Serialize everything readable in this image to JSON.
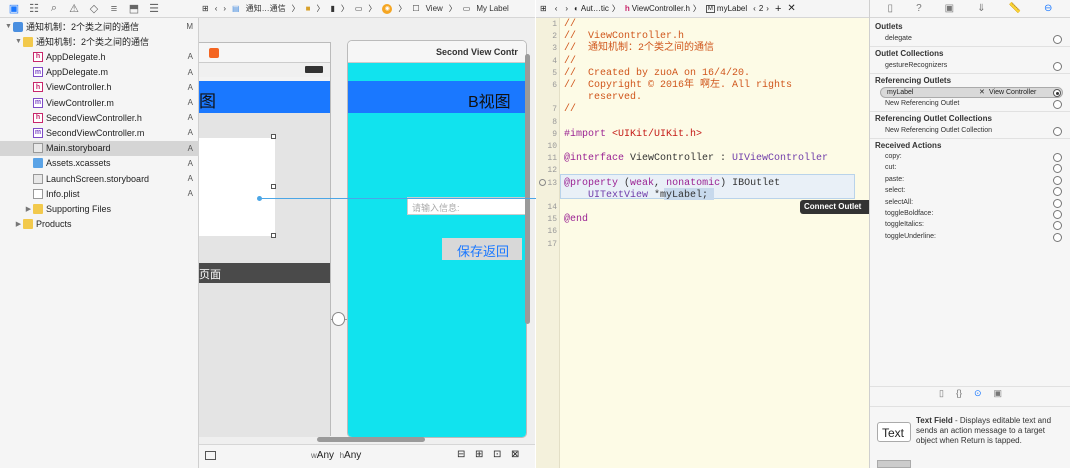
{
  "navigator": {
    "rows": [
      {
        "label": "通知机制：2个类之间的通信",
        "status": "M",
        "icon": "project-icon",
        "indent": 0,
        "disclosure": "▼"
      },
      {
        "label": "通知机制：2个类之间的通信",
        "status": "",
        "icon": "folder-icon",
        "indent": 1,
        "disclosure": "▼"
      },
      {
        "label": "AppDelegate.h",
        "status": "A",
        "icon": "header-file-icon",
        "indent": 2
      },
      {
        "label": "AppDelegate.m",
        "status": "A",
        "icon": "implementation-file-icon",
        "indent": 2
      },
      {
        "label": "ViewController.h",
        "status": "A",
        "icon": "header-file-icon",
        "indent": 2
      },
      {
        "label": "ViewController.m",
        "status": "A",
        "icon": "implementation-file-icon",
        "indent": 2
      },
      {
        "label": "SecondViewController.h",
        "status": "A",
        "icon": "header-file-icon",
        "indent": 2
      },
      {
        "label": "SecondViewController.m",
        "status": "A",
        "icon": "implementation-file-icon",
        "indent": 2
      },
      {
        "label": "Main.storyboard",
        "status": "A",
        "icon": "storyboard-icon",
        "indent": 2,
        "selected": true
      },
      {
        "label": "Assets.xcassets",
        "status": "A",
        "icon": "asset-catalog-icon",
        "indent": 2
      },
      {
        "label": "LaunchScreen.storyboard",
        "status": "A",
        "icon": "storyboard-icon",
        "indent": 2
      },
      {
        "label": "Info.plist",
        "status": "A",
        "icon": "plist-icon",
        "indent": 2
      },
      {
        "label": "Supporting Files",
        "status": "",
        "icon": "folder-icon",
        "indent": 2,
        "disclosure": "▶"
      },
      {
        "label": "Products",
        "status": "",
        "icon": "folder-icon",
        "indent": 1,
        "disclosure": "▶"
      }
    ]
  },
  "ib_jumpbar": {
    "seg1": "通知…通信",
    "seg2": "View",
    "seg3": "My Label"
  },
  "canvas": {
    "scene1_title_partial": "图",
    "scene1_footer_partial": "页面",
    "scene2_title": "Second View Contr",
    "scene2_header": "B视图",
    "scene2_placeholder": "请输入信息:",
    "scene2_button": "保存返回",
    "connect_tooltip": "Connect Outlet"
  },
  "ib_bottom": {
    "w_prefix": "w",
    "w_label": "Any",
    "h_prefix": "h",
    "h_label": "Any"
  },
  "editor_jumpbar": {
    "seg1": "Aut…tic",
    "seg2": "ViewController.h",
    "seg3": "myLabel",
    "counter": "2"
  },
  "code": [
    {
      "n": "1",
      "parts": [
        {
          "c": "com",
          "t": "//"
        }
      ]
    },
    {
      "n": "2",
      "parts": [
        {
          "c": "com",
          "t": "//  ViewController.h"
        }
      ]
    },
    {
      "n": "3",
      "parts": [
        {
          "c": "com",
          "t": "//  通知机制：2个类之间的通信"
        }
      ]
    },
    {
      "n": "4",
      "parts": [
        {
          "c": "com",
          "t": "//"
        }
      ]
    },
    {
      "n": "5",
      "parts": [
        {
          "c": "com",
          "t": "//  Created by zuoA on 16/4/20."
        }
      ]
    },
    {
      "n": "6",
      "parts": [
        {
          "c": "com",
          "t": "//  Copyright © 2016年 啊左. All rights"
        }
      ]
    },
    {
      "n": "",
      "parts": [
        {
          "c": "com",
          "t": "    reserved."
        }
      ]
    },
    {
      "n": "7",
      "parts": [
        {
          "c": "com",
          "t": "//"
        }
      ]
    },
    {
      "n": "8",
      "parts": [
        {
          "c": "plain",
          "t": ""
        }
      ]
    },
    {
      "n": "9",
      "parts": [
        {
          "c": "kw",
          "t": "#import "
        },
        {
          "c": "str",
          "t": "<UIKit/UIKit.h>"
        }
      ]
    },
    {
      "n": "10",
      "parts": [
        {
          "c": "plain",
          "t": ""
        }
      ]
    },
    {
      "n": "11",
      "parts": [
        {
          "c": "kw",
          "t": "@interface "
        },
        {
          "c": "plain",
          "t": "ViewController : "
        },
        {
          "c": "type",
          "t": "UIViewController"
        }
      ]
    },
    {
      "n": "12",
      "parts": [
        {
          "c": "plain",
          "t": ""
        }
      ]
    },
    {
      "n": "13",
      "parts": [
        {
          "c": "kw",
          "t": "@property "
        },
        {
          "c": "plain",
          "t": "("
        },
        {
          "c": "kw",
          "t": "weak"
        },
        {
          "c": "plain",
          "t": ", "
        },
        {
          "c": "kw",
          "t": "nonatomic"
        },
        {
          "c": "plain",
          "t": ") IBOutlet"
        }
      ]
    },
    {
      "n": "",
      "parts": [
        {
          "c": "type",
          "t": "    UITextView"
        },
        {
          "c": "plain",
          "t": " *myLabel;"
        }
      ]
    },
    {
      "n": "14",
      "parts": [
        {
          "c": "plain",
          "t": ""
        }
      ]
    },
    {
      "n": "15",
      "parts": [
        {
          "c": "kw",
          "t": "@end"
        }
      ]
    },
    {
      "n": "16",
      "parts": [
        {
          "c": "plain",
          "t": ""
        }
      ]
    },
    {
      "n": "17",
      "parts": [
        {
          "c": "plain",
          "t": ""
        }
      ]
    }
  ],
  "inspector": {
    "outlets_title": "Outlets",
    "outlets": [
      "delegate"
    ],
    "outlet_collections_title": "Outlet Collections",
    "outlet_collections": [
      "gestureRecognizers"
    ],
    "referencing_outlets_title": "Referencing Outlets",
    "ref_outlet_name": "myLabel",
    "ref_outlet_target": "View Controller",
    "new_ref_outlet": "New Referencing Outlet",
    "ref_outlet_collections_title": "Referencing Outlet Collections",
    "new_ref_outlet_collection": "New Referencing Outlet Collection",
    "received_actions_title": "Received Actions",
    "actions": [
      "copy:",
      "cut:",
      "paste:",
      "select:",
      "selectAll:",
      "toggleBoldface:",
      "toggleItalics:",
      "toggleUnderline:"
    ],
    "library_item_label": "Text",
    "library_item_title": "Text Field",
    "library_item_desc": " - Displays editable text and sends an action message to a target object when Return is tapped."
  }
}
